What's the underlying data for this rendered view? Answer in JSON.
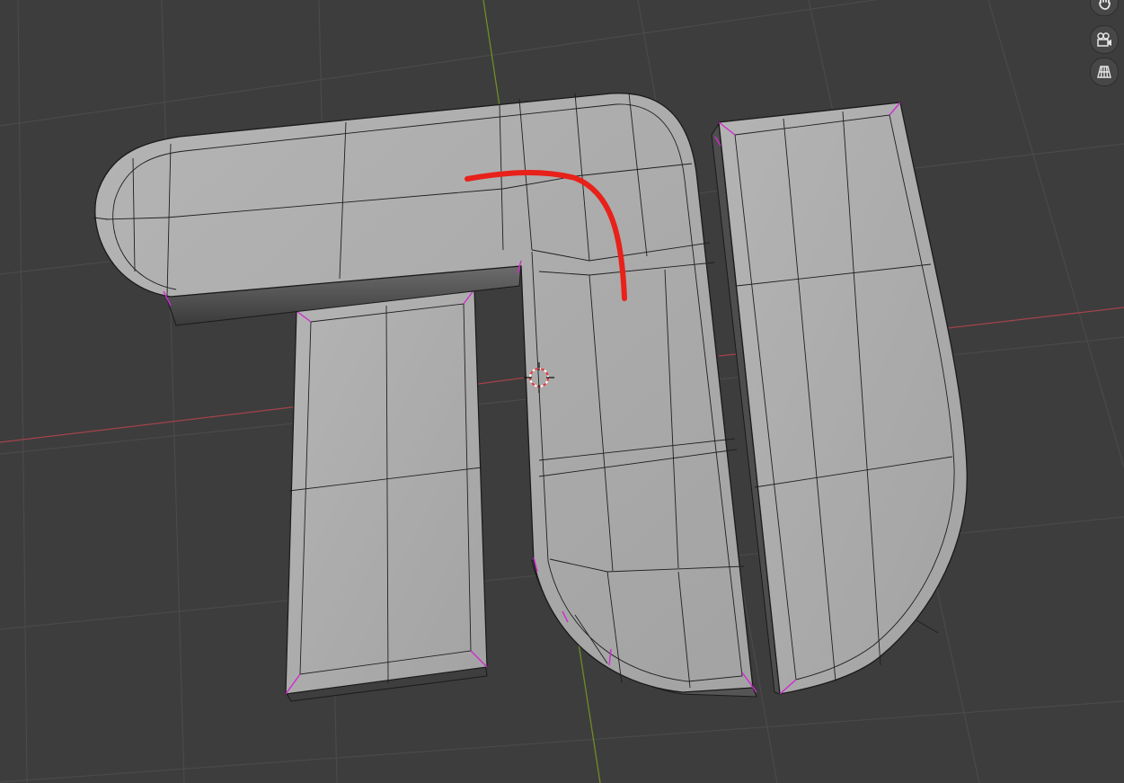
{
  "viewport": {
    "background": "#3d3d3d",
    "grid_color": "#494949",
    "x_axis_color": "#b04a52",
    "y_axis_color": "#7c9a2a",
    "mesh_face_color": "#a9a9a9",
    "mesh_edge_color": "#1a1a1a",
    "seam_color": "#d02bd0",
    "annotation_color": "#e8211a"
  },
  "objects": [
    "letter-t-top-bar",
    "letter-t-left-leg",
    "letter-t-right-hook",
    "letter-i-bar"
  ],
  "nav_gizmo": {
    "buttons": [
      {
        "id": "pan",
        "icon": "hand-icon"
      },
      {
        "id": "camera",
        "icon": "camera-icon"
      },
      {
        "id": "ortho",
        "icon": "grid-icon"
      }
    ]
  }
}
